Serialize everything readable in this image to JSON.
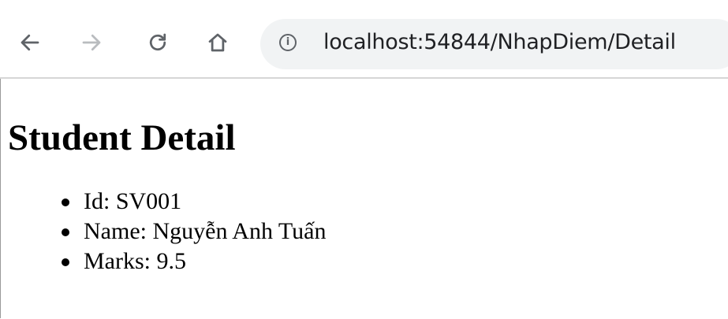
{
  "browser": {
    "url": "localhost:54844/NhapDiem/Detail",
    "icons": {
      "back": "arrow-left-icon",
      "forward": "arrow-right-icon",
      "reload": "reload-icon",
      "home": "home-icon",
      "site_info": "info-icon"
    }
  },
  "page": {
    "title": "Student Detail",
    "items": [
      {
        "text": "Id: SV001"
      },
      {
        "text": "Name: Nguyễn Anh Tuấn"
      },
      {
        "text": "Marks: 9.5"
      }
    ]
  }
}
